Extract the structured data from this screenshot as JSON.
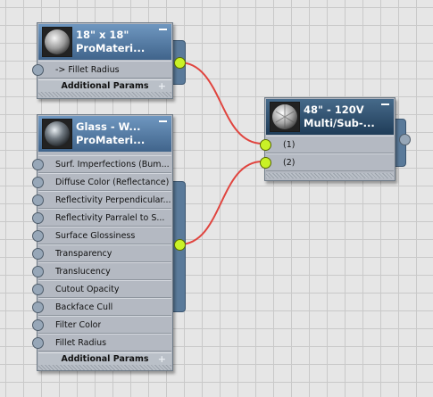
{
  "nodes": {
    "fillet_node": {
      "title_line1": "18\" x 18\"",
      "title_line2": "ProMateri...",
      "thumbnail_icon": "sphere-preview-icon",
      "params": [
        "-> Fillet Radius"
      ],
      "footer": "Additional Params"
    },
    "glass_node": {
      "title_line1": "Glass - W...",
      "title_line2": "ProMateri...",
      "thumbnail_icon": "glass-sphere-preview-icon",
      "params": [
        "Surf. Imperfections (Bum...",
        "Diffuse Color (Reflectance)",
        "Reflectivity Perpendicular...",
        "Reflectivity Parralel to S...",
        "Surface Glossiness",
        "Transparency",
        "Translucency",
        "Cutout Opacity",
        "Backface Cull",
        "Filter Color",
        "Fillet Radius"
      ],
      "footer": "Additional Params"
    },
    "multi_node": {
      "title_line1": "48\" - 120V",
      "title_line2": "Multi/Sub-...",
      "thumbnail_icon": "multi-sub-sphere-preview-icon",
      "params": [
        "(1)",
        "(2)"
      ]
    }
  },
  "colors": {
    "active_socket": "#c9f227",
    "wire": "#e0443e",
    "header_blue": "#5a7fa8",
    "header_dark": "#2f4e6e"
  }
}
